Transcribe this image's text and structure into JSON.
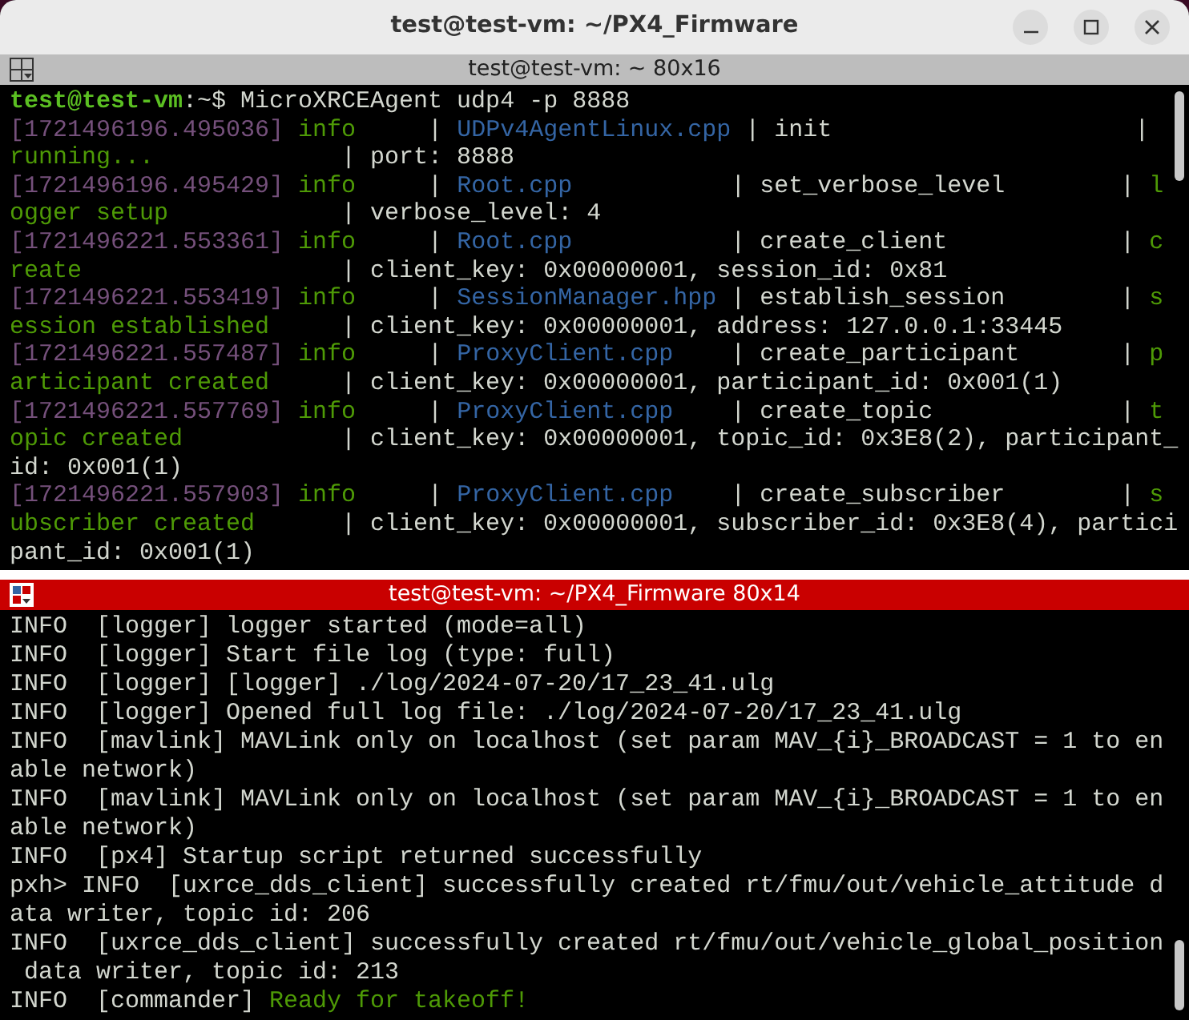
{
  "window": {
    "title": "test@test-vm: ~/PX4_Firmware"
  },
  "panes": [
    {
      "title": "test@test-vm: ~ 80x16",
      "focused": false,
      "lines": [
        {
          "segments": [
            {
              "text": "test@test-vm",
              "kind": "user"
            },
            {
              "text": ":~$ MicroXRCEAgent udp4 -p 8888",
              "kind": "plain"
            }
          ]
        },
        {
          "segments": [
            {
              "text": "[1721496196.495036]",
              "kind": "stamp"
            },
            {
              "text": " info",
              "kind": "ok"
            },
            {
              "text": "     | ",
              "kind": "plain"
            },
            {
              "text": "UDPv4AgentLinux.cpp",
              "kind": "file"
            },
            {
              "text": " | init                     |",
              "kind": "plain"
            }
          ]
        },
        {
          "segments": [
            {
              "text": "running...",
              "kind": "ok"
            },
            {
              "text": "             | port: 8888",
              "kind": "plain"
            }
          ]
        },
        {
          "segments": [
            {
              "text": "[1721496196.495429]",
              "kind": "stamp"
            },
            {
              "text": " info",
              "kind": "ok"
            },
            {
              "text": "     | ",
              "kind": "plain"
            },
            {
              "text": "Root.cpp",
              "kind": "file"
            },
            {
              "text": "           | set_verbose_level        | ",
              "kind": "plain"
            },
            {
              "text": "l",
              "kind": "ok"
            }
          ]
        },
        {
          "segments": [
            {
              "text": "ogger setup",
              "kind": "ok"
            },
            {
              "text": "            | verbose_level: 4",
              "kind": "plain"
            }
          ]
        },
        {
          "segments": [
            {
              "text": "[1721496221.553361]",
              "kind": "stamp"
            },
            {
              "text": " info",
              "kind": "ok"
            },
            {
              "text": "     | ",
              "kind": "plain"
            },
            {
              "text": "Root.cpp",
              "kind": "file"
            },
            {
              "text": "           | create_client            | ",
              "kind": "plain"
            },
            {
              "text": "c",
              "kind": "ok"
            }
          ]
        },
        {
          "segments": [
            {
              "text": "reate",
              "kind": "ok"
            },
            {
              "text": "                  | client_key: 0x00000001, session_id: 0x81",
              "kind": "plain"
            }
          ]
        },
        {
          "segments": [
            {
              "text": "[1721496221.553419]",
              "kind": "stamp"
            },
            {
              "text": " info",
              "kind": "ok"
            },
            {
              "text": "     | ",
              "kind": "plain"
            },
            {
              "text": "SessionManager.hpp",
              "kind": "file"
            },
            {
              "text": " | establish_session        | ",
              "kind": "plain"
            },
            {
              "text": "s",
              "kind": "ok"
            }
          ]
        },
        {
          "segments": [
            {
              "text": "ession established",
              "kind": "ok"
            },
            {
              "text": "     | client_key: 0x00000001, address: 127.0.0.1:33445",
              "kind": "plain"
            }
          ]
        },
        {
          "segments": [
            {
              "text": "[1721496221.557487]",
              "kind": "stamp"
            },
            {
              "text": " info",
              "kind": "ok"
            },
            {
              "text": "     | ",
              "kind": "plain"
            },
            {
              "text": "ProxyClient.cpp",
              "kind": "file"
            },
            {
              "text": "    | create_participant       | ",
              "kind": "plain"
            },
            {
              "text": "p",
              "kind": "ok"
            }
          ]
        },
        {
          "segments": [
            {
              "text": "articipant created",
              "kind": "ok"
            },
            {
              "text": "     | client_key: 0x00000001, participant_id: 0x001(1)",
              "kind": "plain"
            }
          ]
        },
        {
          "segments": [
            {
              "text": "[1721496221.557769]",
              "kind": "stamp"
            },
            {
              "text": " info",
              "kind": "ok"
            },
            {
              "text": "     | ",
              "kind": "plain"
            },
            {
              "text": "ProxyClient.cpp",
              "kind": "file"
            },
            {
              "text": "    | create_topic             | ",
              "kind": "plain"
            },
            {
              "text": "t",
              "kind": "ok"
            }
          ]
        },
        {
          "segments": [
            {
              "text": "opic created",
              "kind": "ok"
            },
            {
              "text": "           | client_key: 0x00000001, topic_id: 0x3E8(2), participant_",
              "kind": "plain"
            }
          ]
        },
        {
          "segments": [
            {
              "text": "id: 0x001(1)",
              "kind": "plain"
            }
          ]
        },
        {
          "segments": [
            {
              "text": "[1721496221.557903]",
              "kind": "stamp"
            },
            {
              "text": " info",
              "kind": "ok"
            },
            {
              "text": "     | ",
              "kind": "plain"
            },
            {
              "text": "ProxyClient.cpp",
              "kind": "file"
            },
            {
              "text": "    | create_subscriber        | ",
              "kind": "plain"
            },
            {
              "text": "s",
              "kind": "ok"
            }
          ]
        },
        {
          "segments": [
            {
              "text": "ubscriber created",
              "kind": "ok"
            },
            {
              "text": "      | client_key: 0x00000001, subscriber_id: 0x3E8(4), partici",
              "kind": "plain"
            }
          ]
        },
        {
          "segments": [
            {
              "text": "pant_id: 0x001(1)",
              "kind": "plain"
            }
          ]
        }
      ]
    },
    {
      "title": "test@test-vm: ~/PX4_Firmware 80x14",
      "focused": true,
      "lines": [
        {
          "segments": [
            {
              "text": "INFO  [logger] logger started (mode=all)",
              "kind": "plain"
            }
          ]
        },
        {
          "segments": [
            {
              "text": "INFO  [logger] Start file log (type: full)",
              "kind": "plain"
            }
          ]
        },
        {
          "segments": [
            {
              "text": "INFO  [logger] [logger] ./log/2024-07-20/17_23_41.ulg",
              "kind": "plain"
            }
          ]
        },
        {
          "segments": [
            {
              "text": "INFO  [logger] Opened full log file: ./log/2024-07-20/17_23_41.ulg",
              "kind": "plain"
            }
          ]
        },
        {
          "segments": [
            {
              "text": "INFO  [mavlink] MAVLink only on localhost (set param MAV_{i}_BROADCAST = 1 to en",
              "kind": "plain"
            }
          ]
        },
        {
          "segments": [
            {
              "text": "able network)",
              "kind": "plain"
            }
          ]
        },
        {
          "segments": [
            {
              "text": "INFO  [mavlink] MAVLink only on localhost (set param MAV_{i}_BROADCAST = 1 to en",
              "kind": "plain"
            }
          ]
        },
        {
          "segments": [
            {
              "text": "able network)",
              "kind": "plain"
            }
          ]
        },
        {
          "segments": [
            {
              "text": "INFO  [px4] Startup script returned successfully",
              "kind": "plain"
            }
          ]
        },
        {
          "segments": [
            {
              "text": "pxh> INFO  [uxrce_dds_client] successfully created rt/fmu/out/vehicle_attitude d",
              "kind": "plain"
            }
          ]
        },
        {
          "segments": [
            {
              "text": "ata writer, topic id: 206",
              "kind": "plain"
            }
          ]
        },
        {
          "segments": [
            {
              "text": "INFO  [uxrce_dds_client] successfully created rt/fmu/out/vehicle_global_position",
              "kind": "plain"
            }
          ]
        },
        {
          "segments": [
            {
              "text": " data writer, topic id: 213",
              "kind": "plain"
            }
          ]
        },
        {
          "segments": [
            {
              "text": "INFO  [commander] ",
              "kind": "plain"
            },
            {
              "text": "Ready for takeoff!",
              "kind": "ok"
            }
          ]
        }
      ]
    }
  ]
}
